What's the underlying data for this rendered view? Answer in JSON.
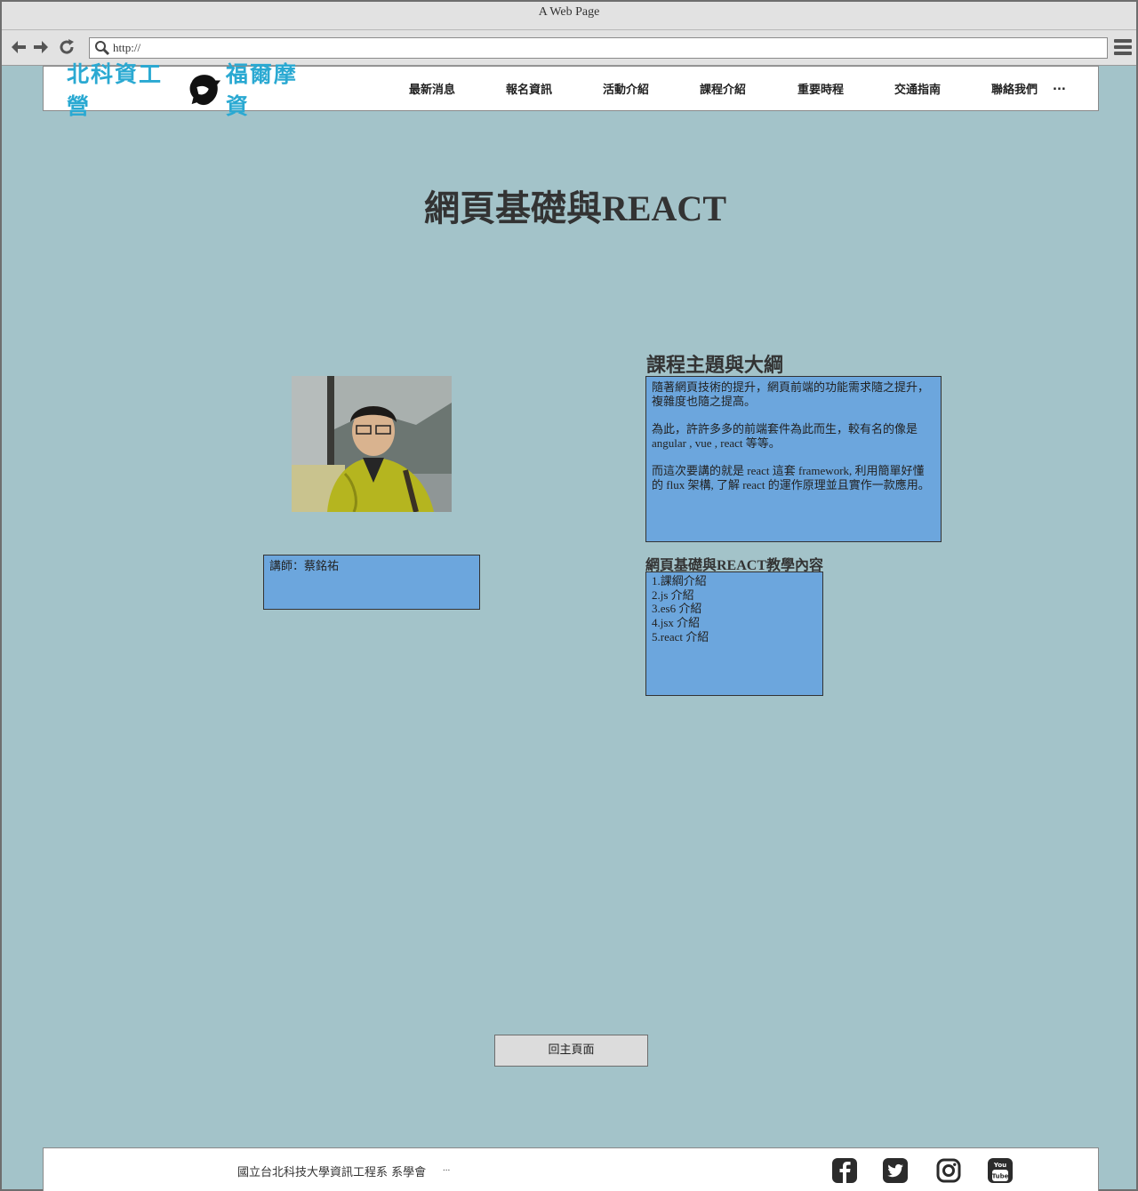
{
  "browser": {
    "title": "A Web Page",
    "url": "http://"
  },
  "header": {
    "logo_left": "北科資工營",
    "logo_right": "福爾摩資",
    "nav": [
      "最新消息",
      "報名資訊",
      "活動介紹",
      "課程介紹",
      "重要時程",
      "交通指南",
      "聯絡我們"
    ],
    "nav_more": "..."
  },
  "main": {
    "page_title": "網頁基礎與REACT",
    "instructor": "講師：蔡銘祐",
    "syllabus_title": "課程主題與大綱",
    "syllabus_paragraphs": [
      "隨著網頁技術的提升，網頁前端的功能需求隨之提升，複雜度也隨之提高。",
      "為此，許許多多的前端套件為此而生，較有名的像是 angular , vue , react 等等。",
      "而這次要講的就是 react 這套 framework, 利用簡單好懂的 flux 架構, 了解 react 的運作原理並且實作一款應用。"
    ],
    "content_title": "網頁基礎與REACT教學內容",
    "content_items": [
      "1.課綱介紹",
      "2.js 介紹",
      "3.es6 介紹",
      "4.jsx 介紹",
      "5.react 介紹"
    ],
    "back_button": "回主頁面"
  },
  "footer": {
    "text": "國立台北科技大學資訊工程系 系學會",
    "more": "...",
    "social_icons": [
      "facebook-icon",
      "twitter-icon",
      "instagram-icon",
      "youtube-icon"
    ],
    "youtube_label": "You Tube"
  },
  "colors": {
    "page_background": "#a3c3c9",
    "box_fill": "#6ca6dd",
    "logo_text": "#2aa9d2"
  }
}
